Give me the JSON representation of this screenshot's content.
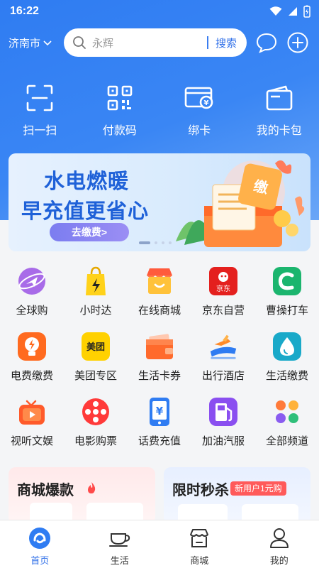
{
  "status": {
    "time": "16:22"
  },
  "header": {
    "city": "济南市",
    "search_placeholder": "永辉",
    "search_button": "搜索"
  },
  "quick_actions": [
    {
      "label": "扫一扫",
      "icon": "scan-icon"
    },
    {
      "label": "付款码",
      "icon": "qr-code-icon"
    },
    {
      "label": "绑卡",
      "icon": "bind-card-icon"
    },
    {
      "label": "我的卡包",
      "icon": "wallet-icon"
    }
  ],
  "banner": {
    "line1": "水电燃暖",
    "line2": "早充值更省心",
    "cta": "去缴费>",
    "badge": "缴"
  },
  "services": [
    {
      "label": "全球购",
      "icon": "global-shopping-icon"
    },
    {
      "label": "小时达",
      "icon": "hour-delivery-icon"
    },
    {
      "label": "在线商城",
      "icon": "online-mall-icon"
    },
    {
      "label": "京东自营",
      "icon": "jd-icon",
      "icon_text": "京东"
    },
    {
      "label": "曹操打车",
      "icon": "caocao-taxi-icon"
    },
    {
      "label": "电费缴费",
      "icon": "electricity-icon"
    },
    {
      "label": "美团专区",
      "icon": "meituan-icon",
      "icon_text": "美团"
    },
    {
      "label": "生活卡券",
      "icon": "coupon-icon"
    },
    {
      "label": "出行酒店",
      "icon": "travel-hotel-icon"
    },
    {
      "label": "生活缴费",
      "icon": "utility-payment-icon"
    },
    {
      "label": "视听文娱",
      "icon": "video-entertainment-icon"
    },
    {
      "label": "电影购票",
      "icon": "movie-ticket-icon"
    },
    {
      "label": "话费充值",
      "icon": "phone-recharge-icon",
      "icon_text": "¥"
    },
    {
      "label": "加油汽服",
      "icon": "fuel-icon"
    },
    {
      "label": "全部频道",
      "icon": "all-channels-icon"
    }
  ],
  "promo_cards": [
    {
      "title": "商城爆款"
    },
    {
      "title": "限时秒杀",
      "tag": "新用户1元购"
    }
  ],
  "tabs": [
    {
      "label": "首页",
      "icon": "home-icon",
      "active": true
    },
    {
      "label": "生活",
      "icon": "coffee-cup-icon"
    },
    {
      "label": "商城",
      "icon": "store-icon"
    },
    {
      "label": "我的",
      "icon": "user-icon"
    }
  ],
  "colors": {
    "primary": "#2f6fe8",
    "hero": "#3a86f4",
    "banner_text": "#1f61d8"
  }
}
